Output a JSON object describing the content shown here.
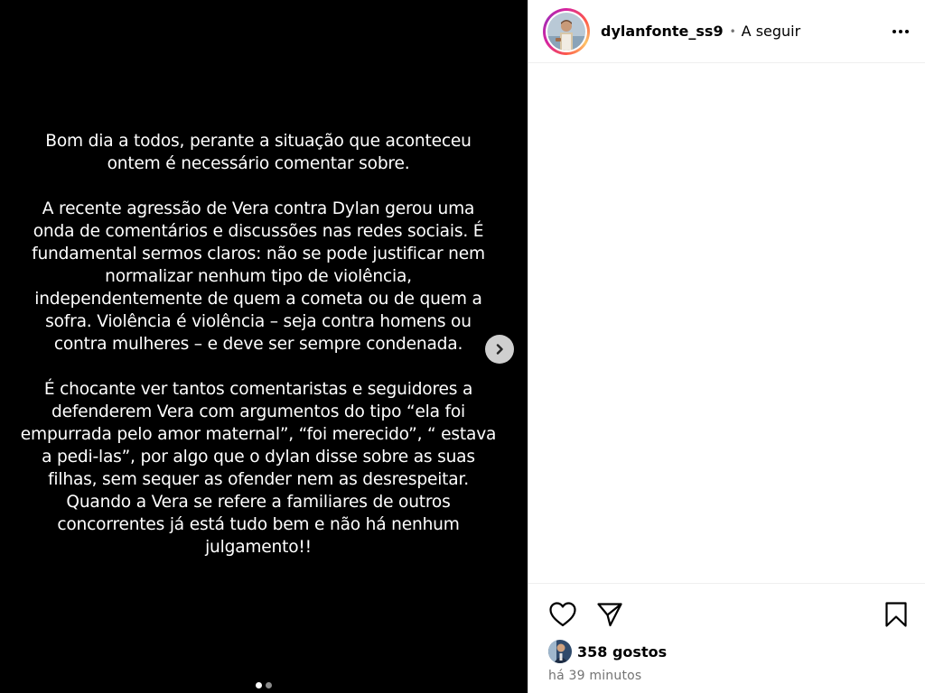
{
  "post": {
    "paragraphs": [
      "Bom dia a todos, perante a situação que aconteceu ontem é necessário comentar sobre.",
      "A recente agressão de Vera contra Dylan gerou uma onda de comentários e discussões nas redes sociais. É fundamental sermos claros: não se pode justificar nem normalizar nenhum tipo de violência, independentemente de quem a cometa ou de quem a sofra. Violência é violência – seja contra homens ou contra mulheres – e deve ser sempre condenada.",
      "É chocante ver tantos comentaristas e seguidores a defenderem Vera com argumentos do tipo “ela foi empurrada pelo amor maternal”, “foi merecido”, “ estava a pedi-las”, por algo que o dylan disse sobre as suas filhas, sem sequer as ofender nem as desrespeitar. Quando a Vera se refere a familiares de outros concorrentes já está tudo bem e não há nenhum julgamento!!"
    ],
    "carousel": {
      "total_slides": 2,
      "active_slide": 1
    }
  },
  "header": {
    "username": "dylanfonte_ss9",
    "separator": "•",
    "follow_label": "A seguir"
  },
  "footer": {
    "likes_label": "358 gostos",
    "time_label": "há 39 minutos"
  },
  "icons": {
    "next": "chevron-right-icon",
    "more": "more-options-icon",
    "like": "heart-icon",
    "share": "paper-plane-icon",
    "save": "bookmark-icon"
  },
  "colors": {
    "media_background": "#000000",
    "panel_background": "#ffffff",
    "secondary_text": "#737373",
    "story_ring_start": "#d6249f",
    "story_ring_end": "#fdc468"
  }
}
